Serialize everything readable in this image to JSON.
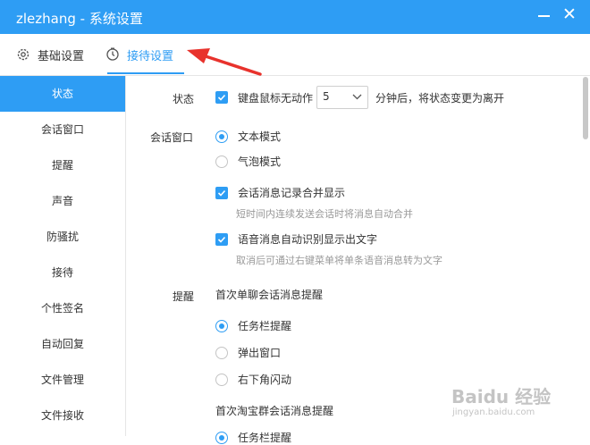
{
  "window": {
    "title": "zlezhang - 系统设置"
  },
  "tabs": [
    {
      "label": "基础设置",
      "icon": "gear-icon"
    },
    {
      "label": "接待设置",
      "icon": "clock-icon",
      "active": true
    }
  ],
  "sidebar": {
    "items": [
      {
        "label": "状态",
        "active": true
      },
      {
        "label": "会话窗口"
      },
      {
        "label": "提醒"
      },
      {
        "label": "声音"
      },
      {
        "label": "防骚扰"
      },
      {
        "label": "接待"
      },
      {
        "label": "个性签名"
      },
      {
        "label": "自动回复"
      },
      {
        "label": "文件管理"
      },
      {
        "label": "文件接收"
      }
    ]
  },
  "status": {
    "label": "状态",
    "idle_checkbox": "键盘鼠标无动作",
    "idle_minutes": "5",
    "idle_suffix": "分钟后，将状态变更为离开"
  },
  "chat_window": {
    "label": "会话窗口",
    "mode_text": "文本模式",
    "mode_bubble": "气泡模式",
    "merge_checkbox": "会话消息记录合并显示",
    "merge_hint": "短时间内连续发送会话时将消息自动合并",
    "voice_checkbox": "语音消息自动识别显示出文字",
    "voice_hint": "取消后可通过右键菜单将单条语音消息转为文字"
  },
  "reminder": {
    "label": "提醒",
    "single_title": "首次单聊会话消息提醒",
    "opt_taskbar": "任务栏提醒",
    "opt_popup": "弹出窗口",
    "opt_flash": "右下角闪动",
    "group_title": "首次淘宝群会话消息提醒",
    "group_opt_taskbar": "任务栏提醒"
  },
  "watermark": {
    "brand": "Baidu 经验",
    "url": "jingyan.baidu.com"
  },
  "colors": {
    "accent": "#2e9df4",
    "annotation_arrow": "#e8322c"
  }
}
